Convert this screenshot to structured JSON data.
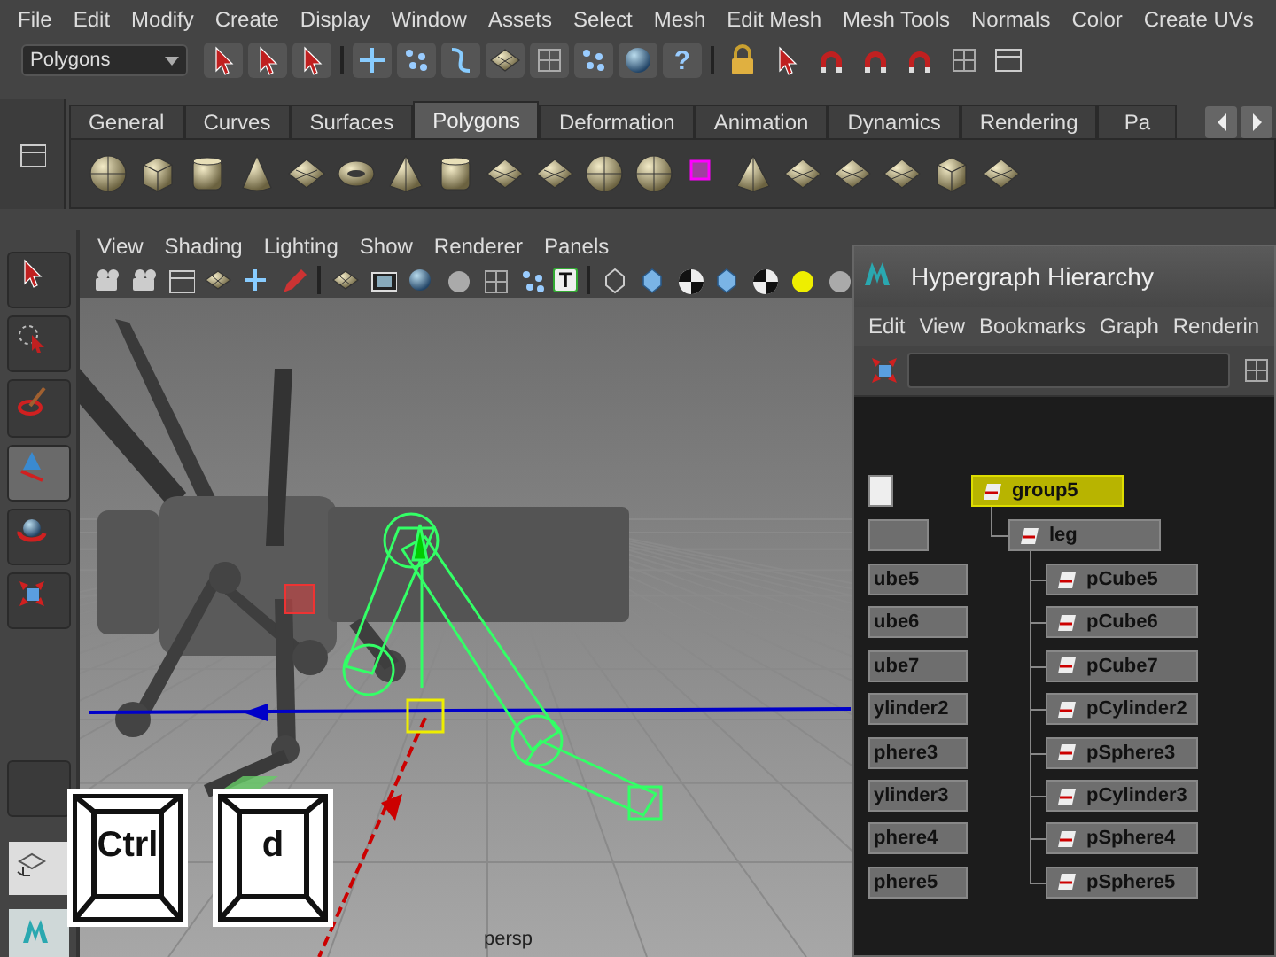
{
  "menu_bar": [
    "File",
    "Edit",
    "Modify",
    "Create",
    "Display",
    "Window",
    "Assets",
    "Select",
    "Mesh",
    "Edit Mesh",
    "Mesh Tools",
    "Normals",
    "Color",
    "Create UVs"
  ],
  "status_line": {
    "mode_menu": "Polygons",
    "help_button": "?"
  },
  "shelf": {
    "tabs": [
      {
        "label": "General",
        "selected": false
      },
      {
        "label": "Curves",
        "selected": false
      },
      {
        "label": "Surfaces",
        "selected": false
      },
      {
        "label": "Polygons",
        "selected": true
      },
      {
        "label": "Deformation",
        "selected": false
      },
      {
        "label": "Animation",
        "selected": false
      },
      {
        "label": "Dynamics",
        "selected": false
      },
      {
        "label": "Rendering",
        "selected": false
      },
      {
        "label": "Pa",
        "selected": false
      }
    ]
  },
  "toolbox": [
    {
      "kind": "select",
      "selected": false
    },
    {
      "kind": "lasso",
      "selected": false
    },
    {
      "kind": "paint",
      "selected": false
    },
    {
      "kind": "move",
      "selected": true
    },
    {
      "kind": "rotate",
      "selected": false
    },
    {
      "kind": "scale",
      "selected": false
    }
  ],
  "viewport": {
    "menus": [
      "View",
      "Shading",
      "Lighting",
      "Show",
      "Renderer",
      "Panels"
    ],
    "text_toggle": "T",
    "camera_label": "persp"
  },
  "hypergraph": {
    "title": "Hypergraph Hierarchy",
    "menus": [
      "Edit",
      "View",
      "Bookmarks",
      "Graph",
      "Renderin"
    ],
    "left_nodes": [
      "ube5",
      "ube6",
      "ube7",
      "ylinder2",
      "phere3",
      "ylinder3",
      "phere4",
      "phere5"
    ],
    "tree": [
      {
        "label": "group5",
        "selected": true,
        "children": [
          {
            "label": "leg",
            "selected": false,
            "children": [
              {
                "label": "pCube5",
                "selected": false
              },
              {
                "label": "pCube6",
                "selected": false
              },
              {
                "label": "pCube7",
                "selected": false
              },
              {
                "label": "pCylinder2",
                "selected": false
              },
              {
                "label": "pSphere3",
                "selected": false
              },
              {
                "label": "pCylinder3",
                "selected": false
              },
              {
                "label": "pSphere4",
                "selected": false
              },
              {
                "label": "pSphere5",
                "selected": false
              }
            ]
          }
        ]
      }
    ]
  },
  "key_overlay": [
    "Ctrl",
    "d"
  ]
}
